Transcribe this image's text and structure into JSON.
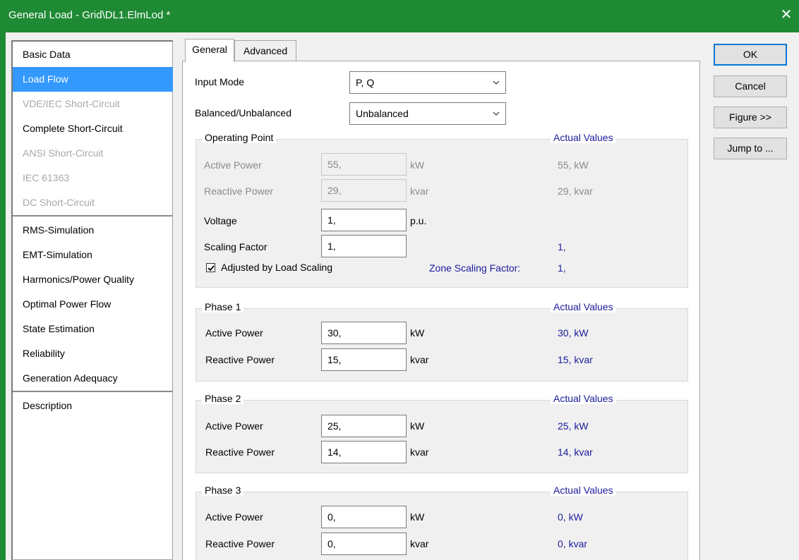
{
  "window": {
    "title": "General Load - Grid\\DL1.ElmLod *",
    "close_glyph": "✕"
  },
  "sidebar": {
    "items": [
      {
        "label": "Basic Data",
        "state": "normal"
      },
      {
        "label": "Load Flow",
        "state": "active"
      },
      {
        "label": "VDE/IEC Short-Circuit",
        "state": "disabled"
      },
      {
        "label": "Complete Short-Circuit",
        "state": "normal"
      },
      {
        "label": "ANSI Short-Circuit",
        "state": "disabled"
      },
      {
        "label": "IEC 61363",
        "state": "disabled"
      },
      {
        "label": "DC Short-Circuit",
        "state": "disabled"
      },
      {
        "label": "RMS-Simulation",
        "state": "normal"
      },
      {
        "label": "EMT-Simulation",
        "state": "normal"
      },
      {
        "label": "Harmonics/Power Quality",
        "state": "normal"
      },
      {
        "label": "Optimal Power Flow",
        "state": "normal"
      },
      {
        "label": "State Estimation",
        "state": "normal"
      },
      {
        "label": "Reliability",
        "state": "normal"
      },
      {
        "label": "Generation Adequacy",
        "state": "normal"
      },
      {
        "label": "Description",
        "state": "normal"
      }
    ]
  },
  "tabs": [
    {
      "label": "General",
      "active": true
    },
    {
      "label": "Advanced",
      "active": false
    }
  ],
  "form": {
    "input_mode_label": "Input Mode",
    "input_mode_value": "P, Q",
    "balanced_label": "Balanced/Unbalanced",
    "balanced_value": "Unbalanced"
  },
  "operating_point": {
    "title": "Operating Point",
    "actual_values_label": "Actual Values",
    "active_power_label": "Active Power",
    "active_power_value": "55,",
    "active_power_unit": "kW",
    "active_power_actual": "55, kW",
    "reactive_power_label": "Reactive Power",
    "reactive_power_value": "29,",
    "reactive_power_unit": "kvar",
    "reactive_power_actual": "29, kvar",
    "voltage_label": "Voltage",
    "voltage_value": "1,",
    "voltage_unit": "p.u.",
    "scaling_label": "Scaling Factor",
    "scaling_value": "1,",
    "scaling_actual": "1,",
    "adjusted_label": "Adjusted by Load Scaling",
    "adjusted_checked": true,
    "zone_scaling_label": "Zone Scaling Factor:",
    "zone_scaling_value": "1,"
  },
  "phases": [
    {
      "title": "Phase 1",
      "actual_values_label": "Actual Values",
      "active_power_label": "Active Power",
      "active_power_value": "30,",
      "active_power_unit": "kW",
      "active_power_actual": "30, kW",
      "reactive_power_label": "Reactive Power",
      "reactive_power_value": "15,",
      "reactive_power_unit": "kvar",
      "reactive_power_actual": "15, kvar"
    },
    {
      "title": "Phase 2",
      "actual_values_label": "Actual Values",
      "active_power_label": "Active Power",
      "active_power_value": "25,",
      "active_power_unit": "kW",
      "active_power_actual": "25, kW",
      "reactive_power_label": "Reactive Power",
      "reactive_power_value": "14,",
      "reactive_power_unit": "kvar",
      "reactive_power_actual": "14, kvar"
    },
    {
      "title": "Phase 3",
      "actual_values_label": "Actual Values",
      "active_power_label": "Active Power",
      "active_power_value": "0,",
      "active_power_unit": "kW",
      "active_power_actual": "0, kW",
      "reactive_power_label": "Reactive Power",
      "reactive_power_value": "0,",
      "reactive_power_unit": "kvar",
      "reactive_power_actual": "0, kvar"
    }
  ],
  "buttons": {
    "ok": "OK",
    "cancel": "Cancel",
    "figure": "Figure >>",
    "jump": "Jump to ..."
  },
  "colors": {
    "titlebar": "#1f8a34",
    "selection": "#3399ff",
    "actual_value_text": "#1a1a9c",
    "default_button_border": "#0078d7"
  }
}
